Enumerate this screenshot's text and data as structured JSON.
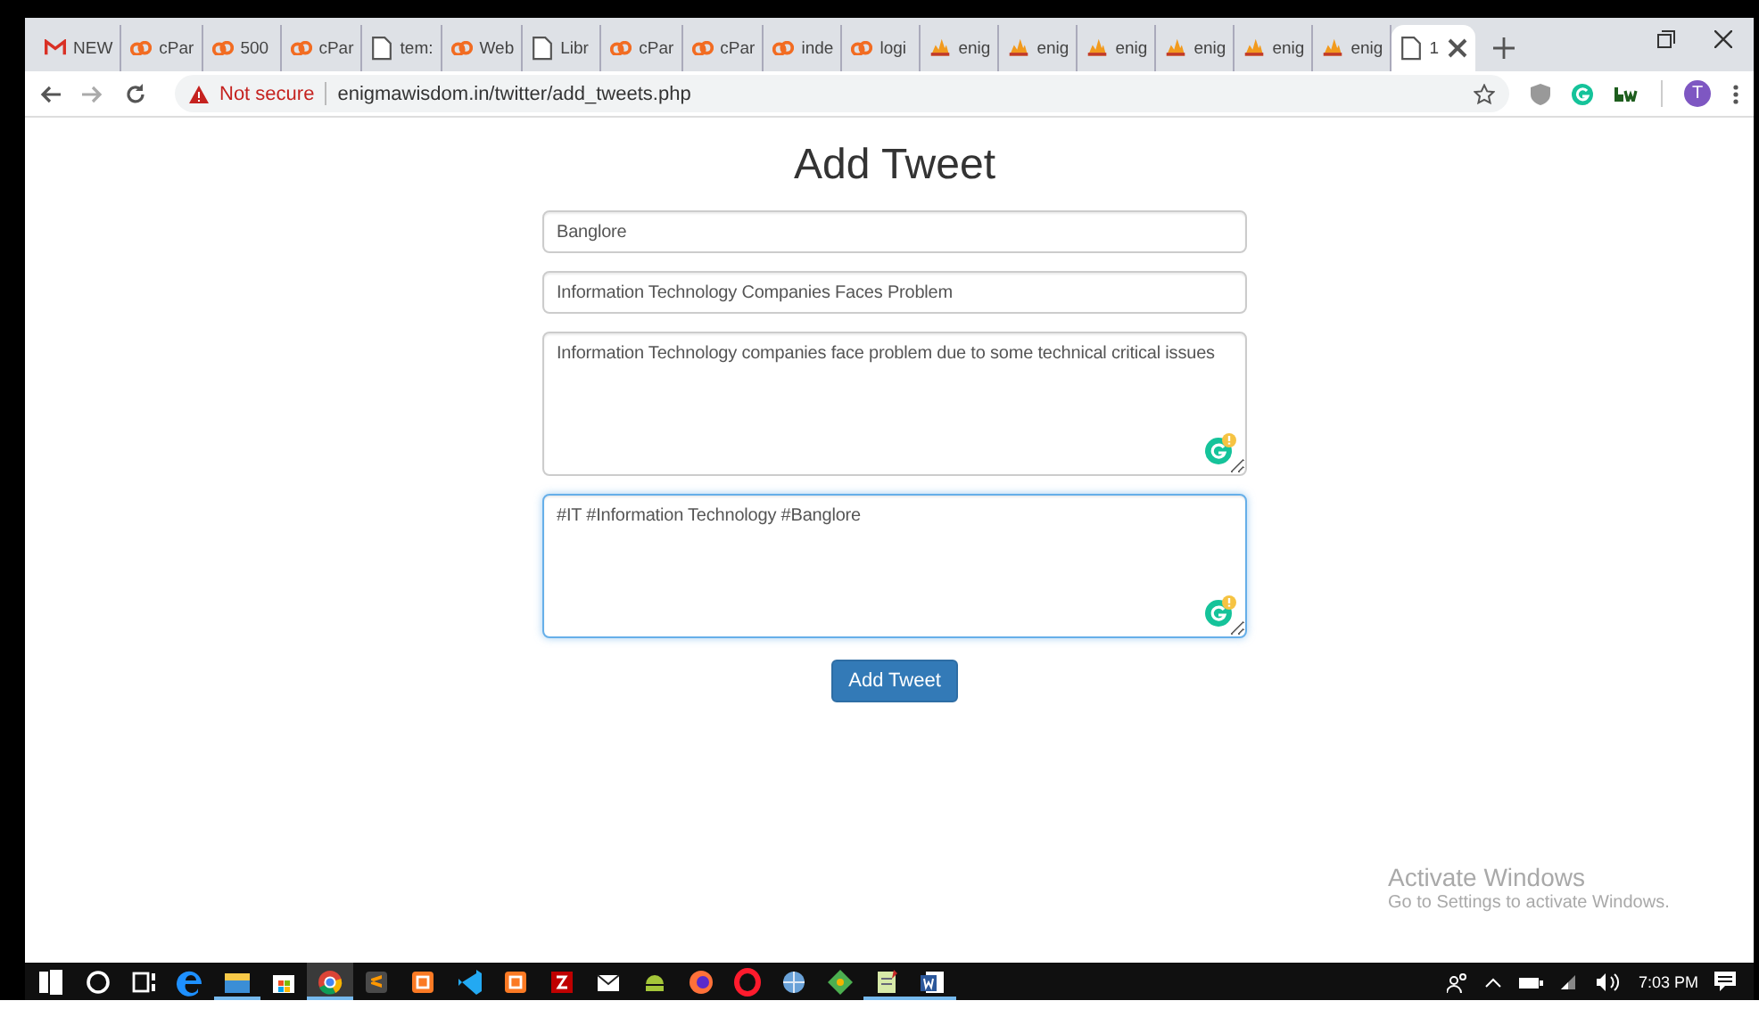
{
  "browser": {
    "tabs": [
      {
        "label": "NEW",
        "kind": "mail",
        "selected": false
      },
      {
        "label": "cPar",
        "kind": "chain",
        "selected": false
      },
      {
        "label": "500",
        "kind": "chain",
        "selected": false
      },
      {
        "label": "cPar",
        "kind": "chain",
        "selected": false
      },
      {
        "label": "tem:",
        "kind": "page",
        "selected": false
      },
      {
        "label": "Web",
        "kind": "chain",
        "selected": false
      },
      {
        "label": "Libr",
        "kind": "page",
        "selected": false
      },
      {
        "label": "cPar",
        "kind": "chain",
        "selected": false
      },
      {
        "label": "cPar",
        "kind": "chain",
        "selected": false
      },
      {
        "label": "inde",
        "kind": "chain",
        "selected": false
      },
      {
        "label": "logi",
        "kind": "chain",
        "selected": false
      },
      {
        "label": "enig",
        "kind": "flame",
        "selected": false
      },
      {
        "label": "enig",
        "kind": "flame",
        "selected": false
      },
      {
        "label": "enig",
        "kind": "flame",
        "selected": false
      },
      {
        "label": "enig",
        "kind": "flame",
        "selected": false
      },
      {
        "label": "enig",
        "kind": "flame",
        "selected": false
      },
      {
        "label": "enig",
        "kind": "flame",
        "selected": false
      },
      {
        "label": "1",
        "kind": "page",
        "selected": true
      }
    ],
    "address": {
      "security": "Not secure",
      "url": "enigmawisdom.in/twitter/add_tweets.php"
    },
    "profile_initial": "T"
  },
  "page": {
    "heading": "Add Tweet",
    "fields": [
      {
        "kind": "input",
        "value": "Banglore",
        "focused": false
      },
      {
        "kind": "input",
        "value": "Information Technology Companies Faces Problem",
        "focused": false
      },
      {
        "kind": "textarea",
        "value": "Information Technology companies face problem due to some technical critical issues",
        "focused": false
      },
      {
        "kind": "textarea",
        "value": "#IT #Information Technology #Banglore",
        "focused": true
      }
    ],
    "submit": "Add Tweet"
  },
  "activation_notice": {
    "title": "Activate Windows",
    "message": "Go to Settings to activate Windows."
  },
  "taskbar": {
    "apps": [
      {
        "kind": "start",
        "running": false,
        "selected": false
      },
      {
        "kind": "cortana",
        "running": false,
        "selected": false
      },
      {
        "kind": "taskview",
        "running": false,
        "selected": false
      },
      {
        "kind": "edge",
        "running": false,
        "selected": false
      },
      {
        "kind": "folder",
        "running": true,
        "selected": false
      },
      {
        "kind": "store",
        "running": false,
        "selected": false
      },
      {
        "kind": "chrome",
        "running": true,
        "selected": true
      },
      {
        "kind": "sublime",
        "running": false,
        "selected": false
      },
      {
        "kind": "xampp",
        "running": false,
        "selected": false
      },
      {
        "kind": "vscode",
        "running": false,
        "selected": false
      },
      {
        "kind": "xampp",
        "running": false,
        "selected": false
      },
      {
        "kind": "filezilla",
        "running": false,
        "selected": false
      },
      {
        "kind": "mail",
        "running": false,
        "selected": false
      },
      {
        "kind": "android",
        "running": false,
        "selected": false
      },
      {
        "kind": "firefox",
        "running": false,
        "selected": false
      },
      {
        "kind": "opera",
        "running": false,
        "selected": false
      },
      {
        "kind": "globe",
        "running": false,
        "selected": false
      },
      {
        "kind": "git",
        "running": false,
        "selected": false
      },
      {
        "kind": "notepad",
        "running": true,
        "selected": false
      },
      {
        "kind": "word",
        "running": true,
        "selected": false
      }
    ],
    "clock": "7:03 PM"
  }
}
